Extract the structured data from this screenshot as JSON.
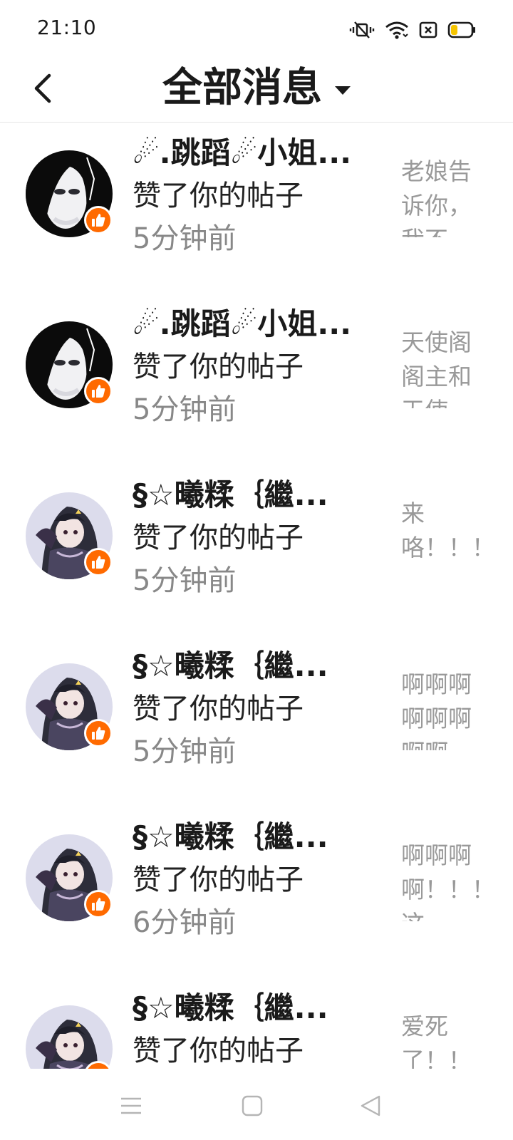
{
  "status_bar": {
    "time": "21:10",
    "icons": [
      "mute-vibrate-icon",
      "wifi-icon",
      "screen-record-icon",
      "battery-icon"
    ]
  },
  "header": {
    "title": "全部消息",
    "back_icon": "back-chevron-icon",
    "dropdown_icon": "caret-down-icon"
  },
  "messages": [
    {
      "name": "☄.跳蹈☄小姐...",
      "action": "赞了你的帖子",
      "time": "5分钟前",
      "preview": "老娘告诉你，我不",
      "avatar": "avatar-mask",
      "badge": "like-icon"
    },
    {
      "name": "☄.跳蹈☄小姐...",
      "action": "赞了你的帖子",
      "time": "5分钟前",
      "preview": "天使阁阁主和天使",
      "avatar": "avatar-mask",
      "badge": "like-icon"
    },
    {
      "name": "§☆曦糅｛繼...",
      "action": "赞了你的帖子",
      "time": "5分钟前",
      "preview": "来咯！！！",
      "avatar": "avatar-anime",
      "badge": "like-icon"
    },
    {
      "name": "§☆曦糅｛繼...",
      "action": "赞了你的帖子",
      "time": "5分钟前",
      "preview": "啊啊啊啊啊啊啊啊",
      "avatar": "avatar-anime",
      "badge": "like-icon"
    },
    {
      "name": "§☆曦糅｛繼...",
      "action": "赞了你的帖子",
      "time": "6分钟前",
      "preview": "啊啊啊啊！！！这",
      "avatar": "avatar-anime",
      "badge": "like-icon"
    },
    {
      "name": "§☆曦糅｛繼...",
      "action": "赞了你的帖子",
      "time": "",
      "preview": "爱死了！！",
      "avatar": "avatar-anime",
      "badge": "like-icon"
    }
  ],
  "bottom_nav": [
    "menu-icon",
    "home-square-icon",
    "back-triangle-icon"
  ],
  "colors": {
    "accent": "#ff6a00",
    "text": "#1a1a1a",
    "muted": "#888888",
    "preview": "#999999"
  }
}
